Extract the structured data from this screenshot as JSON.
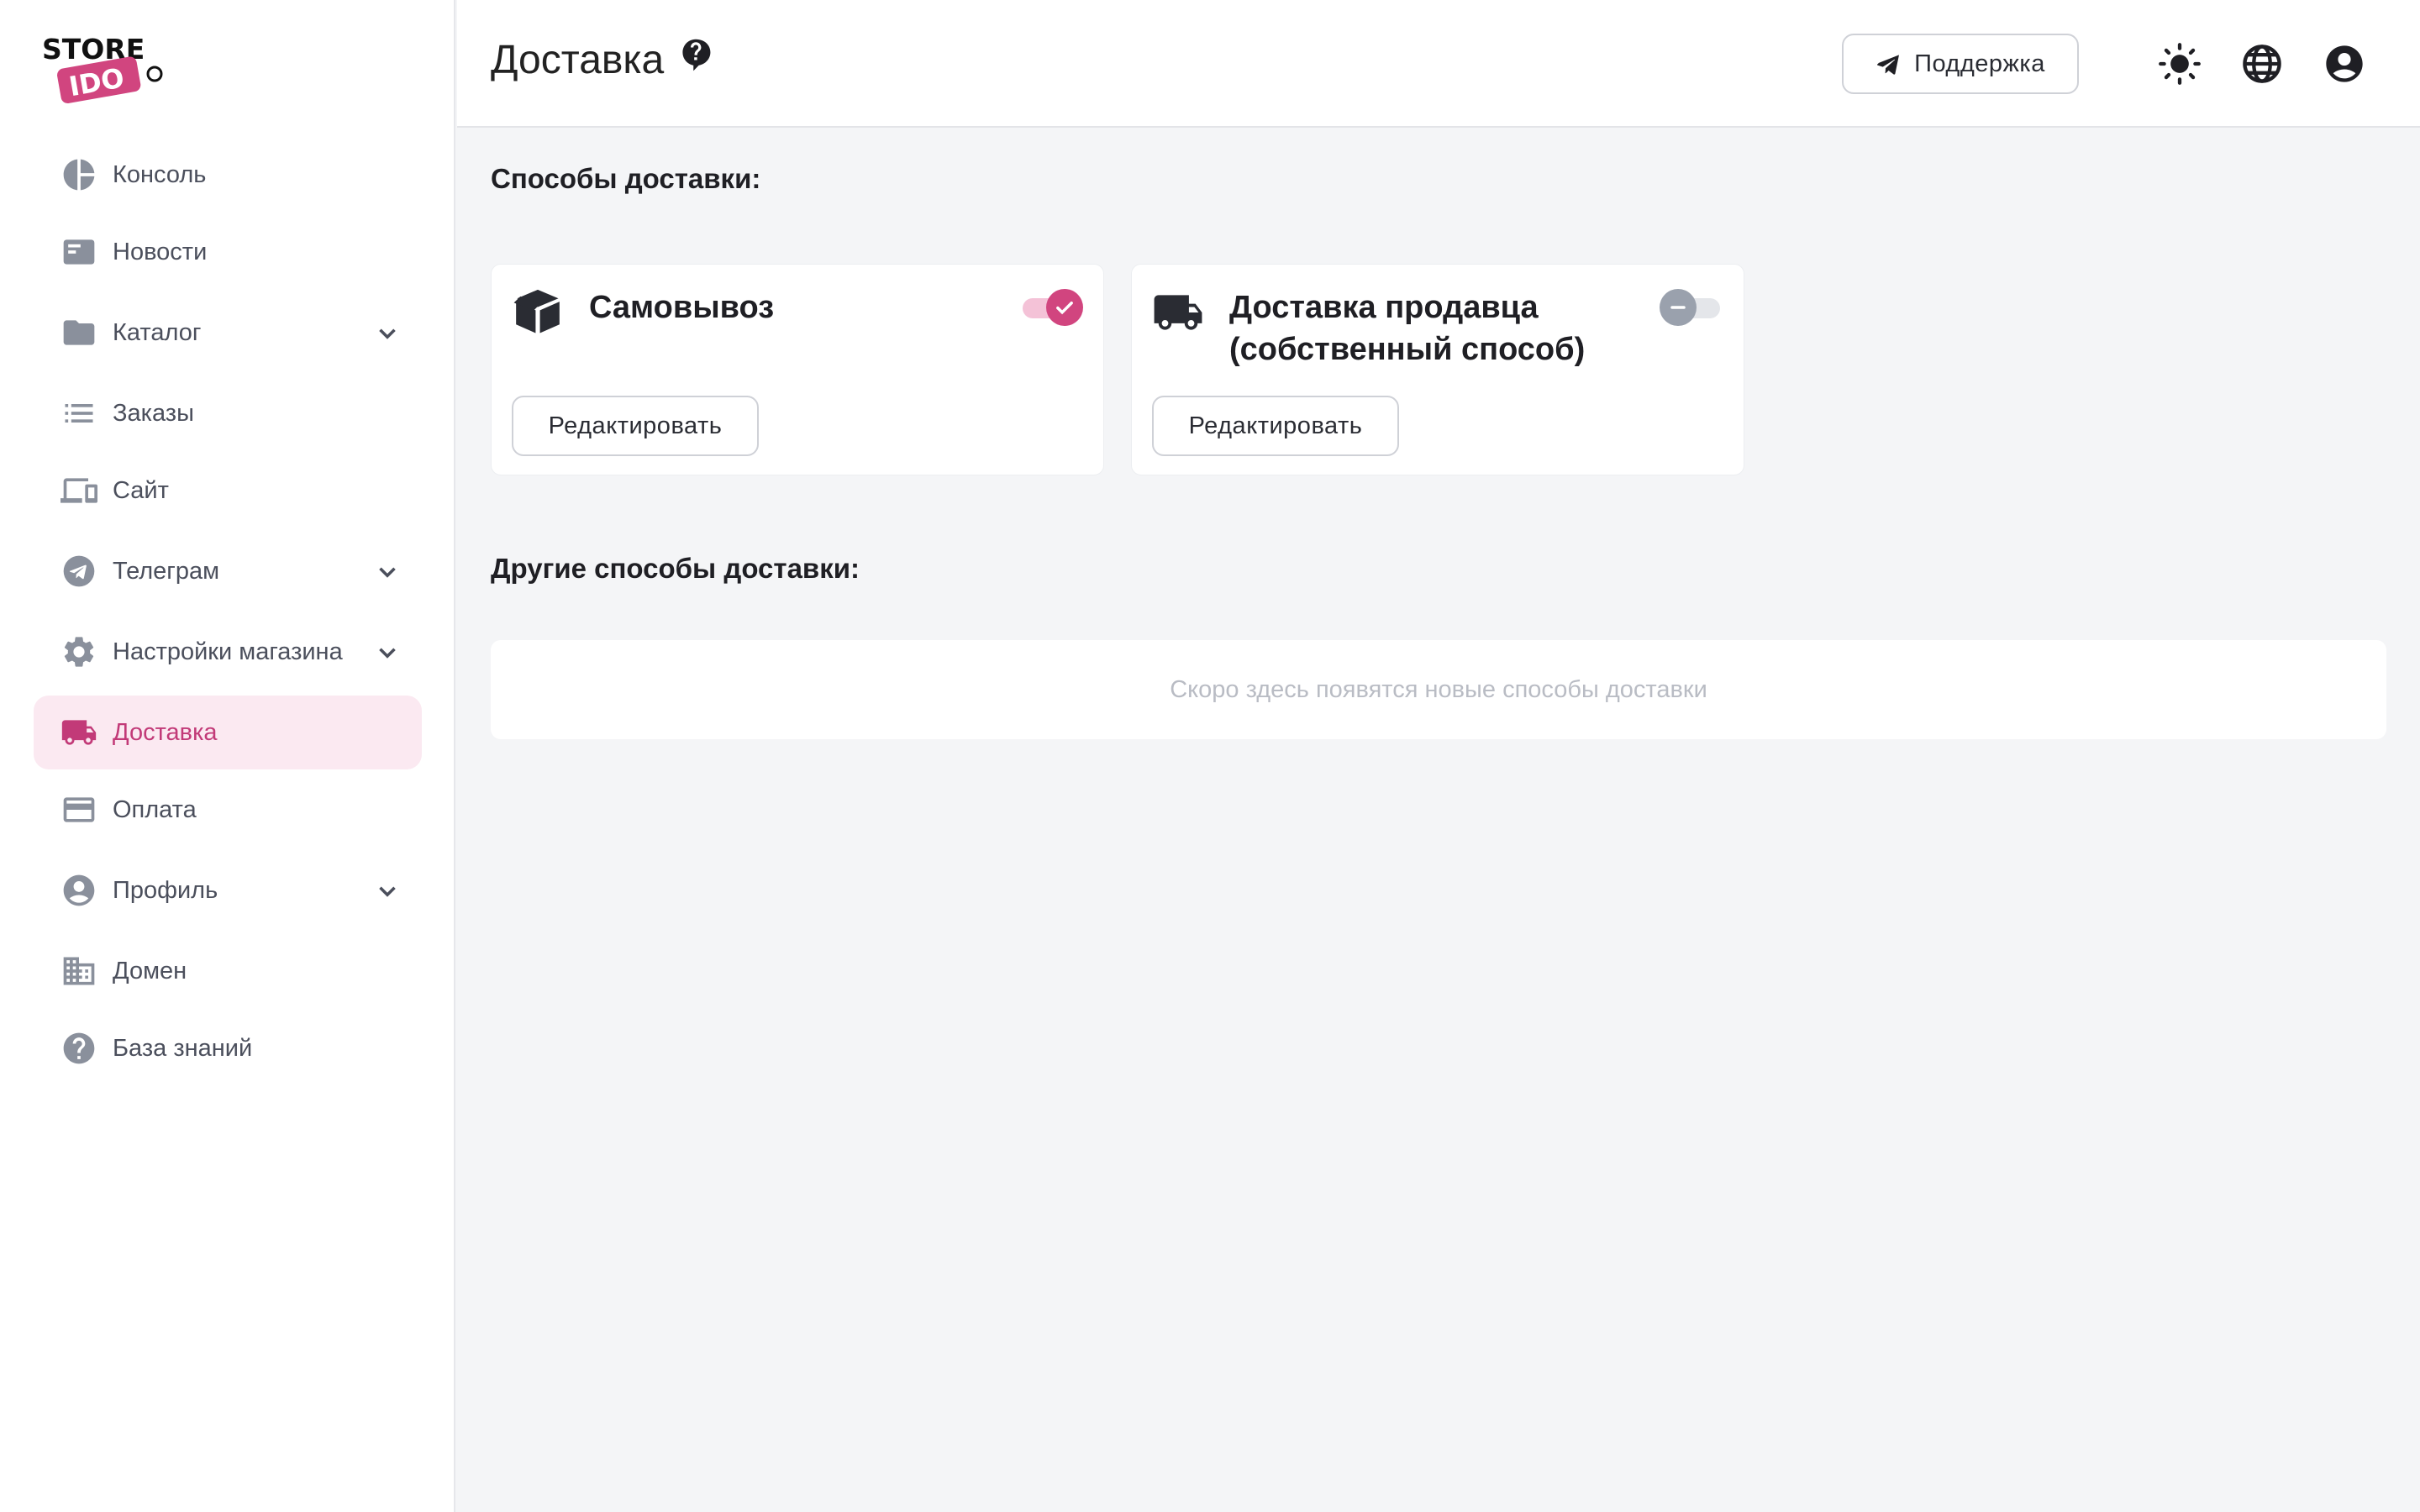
{
  "logo": {
    "line1": "STORE",
    "line2": "IDO"
  },
  "sidebar": {
    "items": [
      {
        "label": "Консоль",
        "icon": "chart-pie-icon",
        "expandable": false
      },
      {
        "label": "Новости",
        "icon": "newspaper-icon",
        "expandable": false
      },
      {
        "label": "Каталог",
        "icon": "folder-icon",
        "expandable": true
      },
      {
        "label": "Заказы",
        "icon": "list-icon",
        "expandable": false
      },
      {
        "label": "Сайт",
        "icon": "devices-icon",
        "expandable": false
      },
      {
        "label": "Телеграм",
        "icon": "telegram-icon",
        "expandable": true
      },
      {
        "label": "Настройки магазина",
        "icon": "gear-icon",
        "expandable": true
      },
      {
        "label": "Доставка",
        "icon": "truck-icon",
        "expandable": false,
        "active": true
      },
      {
        "label": "Оплата",
        "icon": "credit-card-icon",
        "expandable": false
      },
      {
        "label": "Профиль",
        "icon": "user-circle-icon",
        "expandable": true
      },
      {
        "label": "Домен",
        "icon": "building-icon",
        "expandable": false
      },
      {
        "label": "База знаний",
        "icon": "question-circle-icon",
        "expandable": false
      }
    ]
  },
  "header": {
    "title": "Доставка",
    "support_label": "Поддержка"
  },
  "main": {
    "methods_title": "Способы доставки:",
    "methods": [
      {
        "title": "Самовывоз",
        "enabled": true,
        "edit_label": "Редактировать",
        "icon": "box-icon"
      },
      {
        "title": "Доставка продавца (собственный способ)",
        "enabled": false,
        "edit_label": "Редактировать",
        "icon": "truck-icon"
      }
    ],
    "other_title": "Другие способы доставки:",
    "other_empty": "Скоро здесь появятся новые способы доставки"
  },
  "colors": {
    "accent": "#d1457f",
    "accent_bg": "#fbe9f1",
    "background": "#f4f5f7"
  }
}
